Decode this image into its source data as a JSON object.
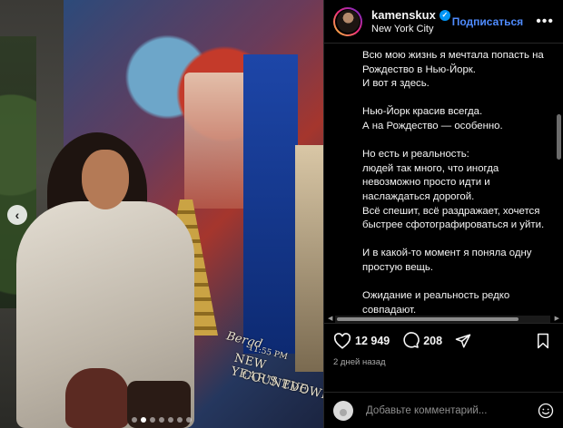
{
  "header": {
    "username": "kamenskux",
    "location": "New York City",
    "follow_label": "Подписаться",
    "more_label": "•••"
  },
  "media": {
    "sign_lines": [
      "Bergd",
      "11:55 PM",
      "NEW YEAR'S EVE",
      "COUNTDOWN"
    ],
    "carousel": {
      "total": 7,
      "active": 1
    }
  },
  "caption": {
    "paragraphs": [
      "Всю мою жизнь я мечтала попасть на Рождество в Нью-Йорк.\nИ вот я здесь.",
      "Нью-Йорк красив всегда.\nА на Рождество — особенно.",
      "Но есть и реальность:\nлюдей так много, что иногда невозможно просто идти и наслаждаться дорогой.\nВсё спешит, всё раздражает, хочется быстрее сфотографироваться и уйти.",
      "И в какой-то момент я поняла одну простую вещь.",
      "Ожидание и реальность редко совпадают.\nНо это не значит, что мечта не"
    ]
  },
  "actions": {
    "likes": "12 949",
    "comments": "208",
    "timestamp": "2 дней назад"
  },
  "comment_box": {
    "placeholder": "Добавьте комментарий..."
  },
  "colors": {
    "accent": "#4f8cff",
    "verified": "#0095f6",
    "background": "#000000"
  },
  "icons": [
    "verified-icon",
    "more-icon",
    "heart-icon",
    "comment-icon",
    "share-icon",
    "bookmark-icon",
    "emoji-icon",
    "chevron-left-icon"
  ]
}
